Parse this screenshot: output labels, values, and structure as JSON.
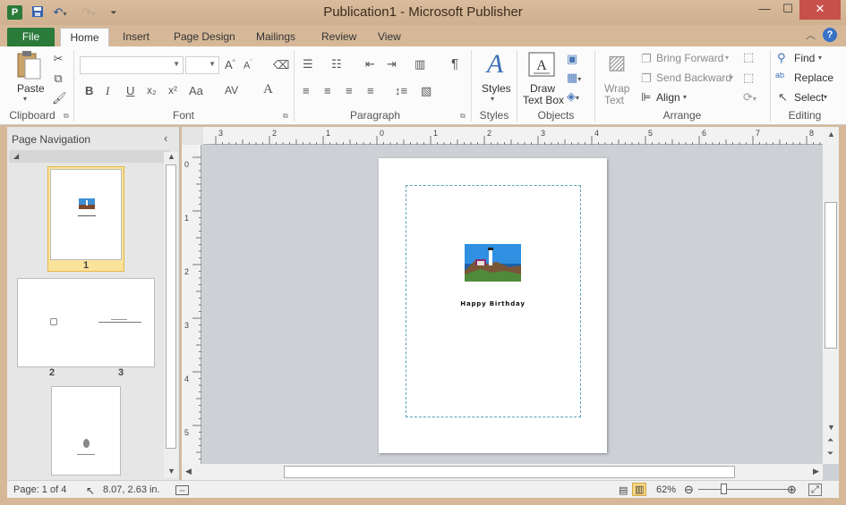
{
  "window": {
    "title": "Publication1  -  Microsoft Publisher",
    "app_icon_letter": "P"
  },
  "tabs": [
    {
      "label": "File"
    },
    {
      "label": "Home"
    },
    {
      "label": "Insert"
    },
    {
      "label": "Page Design"
    },
    {
      "label": "Mailings"
    },
    {
      "label": "Review"
    },
    {
      "label": "View"
    }
  ],
  "ribbon": {
    "clipboard": {
      "paste": "Paste",
      "group": "Clipboard"
    },
    "font": {
      "group": "Font",
      "bold": "B",
      "italic": "I",
      "underline": "U",
      "subscript": "x₂",
      "superscript": "x²",
      "change_case": "Aa"
    },
    "paragraph": {
      "group": "Paragraph",
      "pilcrow": "¶"
    },
    "styles": {
      "label": "Styles",
      "group": "Styles"
    },
    "objects": {
      "draw_text_box_1": "Draw",
      "draw_text_box_2": "Text Box",
      "group": "Objects"
    },
    "arrange": {
      "wrap_text_1": "Wrap",
      "wrap_text_2": "Text",
      "bring_forward": "Bring Forward",
      "send_backward": "Send Backward",
      "align": "Align",
      "group": "Arrange"
    },
    "editing": {
      "find": "Find",
      "replace": "Replace",
      "select": "Select",
      "group": "Editing"
    }
  },
  "nav": {
    "title": "Page Navigation",
    "pages": [
      "1",
      "2",
      "3"
    ]
  },
  "rulers": {
    "horizontal": [
      "3",
      "2",
      "1",
      "0",
      "1",
      "2",
      "3",
      "4",
      "5",
      "6",
      "7",
      "8"
    ],
    "vertical": [
      "0",
      "1",
      "2",
      "3",
      "4",
      "5"
    ]
  },
  "document": {
    "caption": "Happy Birthday"
  },
  "status": {
    "page": "Page: 1 of 4",
    "position": "8.07, 2.63 in.",
    "zoom": "62%"
  }
}
